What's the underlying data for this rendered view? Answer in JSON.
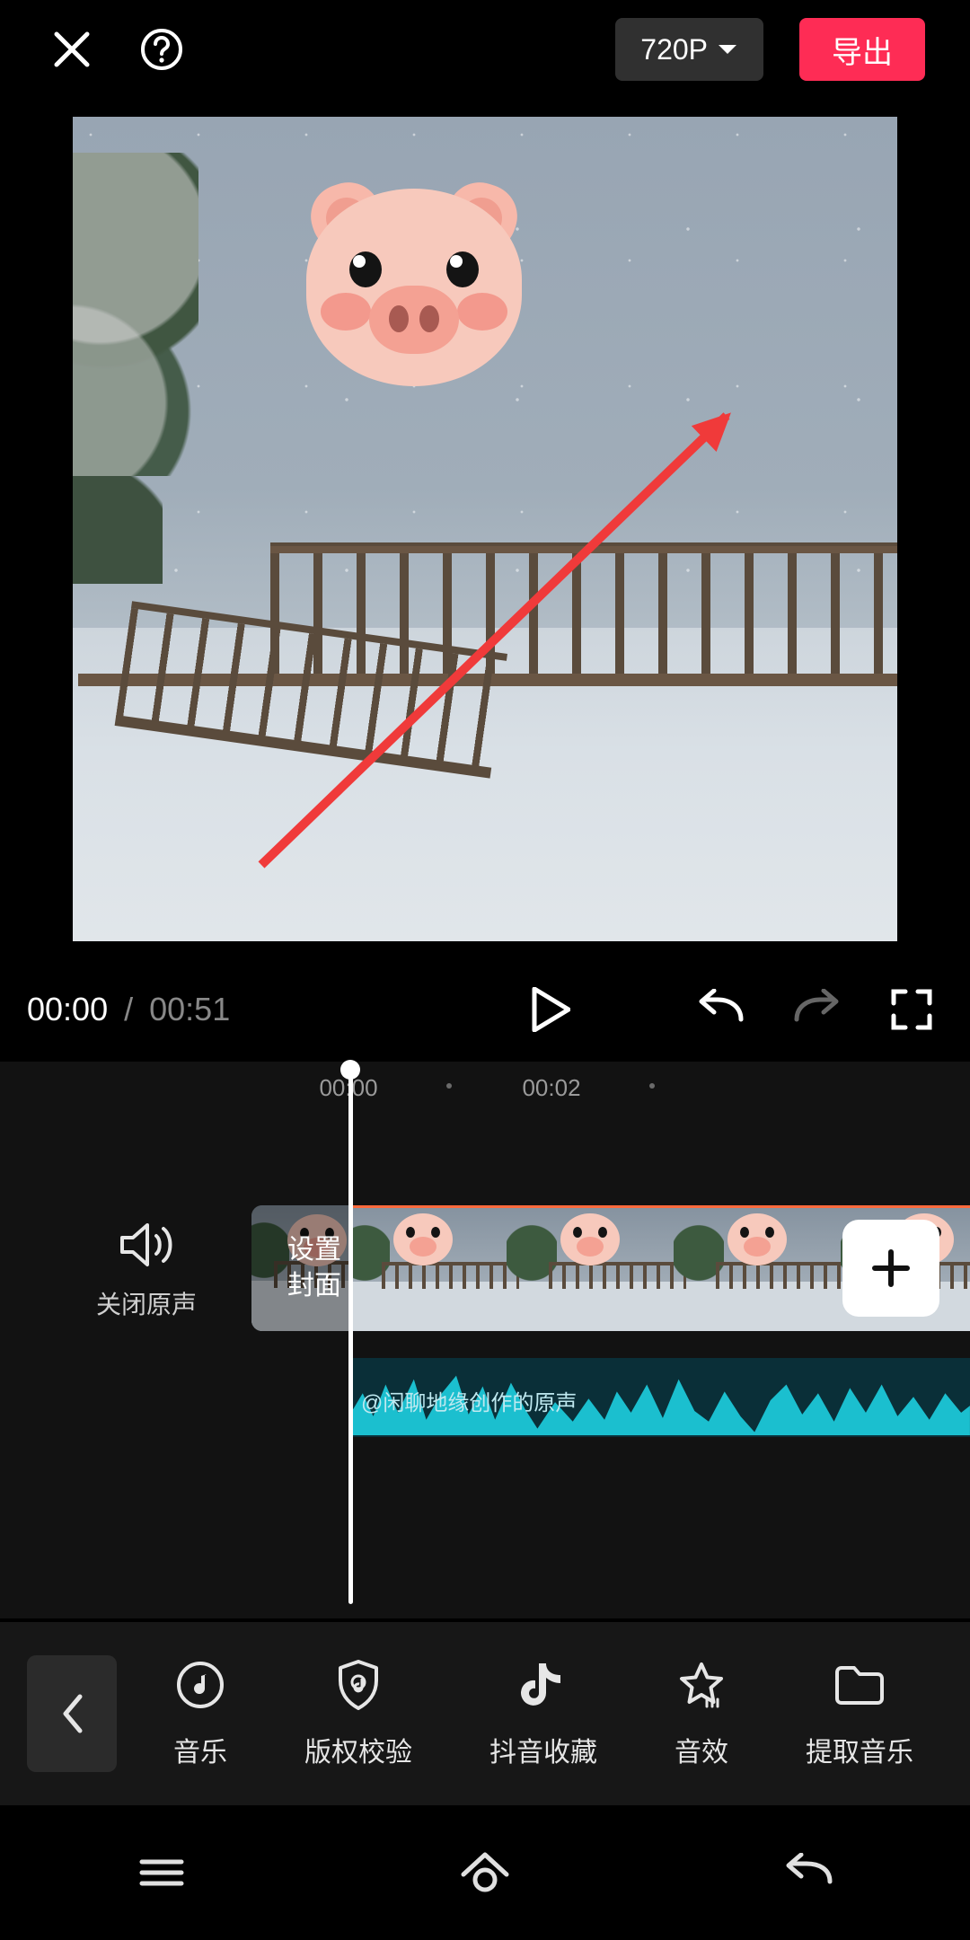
{
  "top": {
    "resolution": "720P",
    "export_label": "导出"
  },
  "transport": {
    "current_time": "00:00",
    "separator": "/",
    "duration": "00:51"
  },
  "ruler": {
    "marks": [
      "00:00",
      "00:02"
    ]
  },
  "timeline": {
    "mute_label": "关闭原声",
    "cover_line1": "设置",
    "cover_line2": "封面",
    "audio_label": "@闲聊地缘创作的原声"
  },
  "toolbar": {
    "items": [
      {
        "label": "音乐"
      },
      {
        "label": "版权校验"
      },
      {
        "label": "抖音收藏"
      },
      {
        "label": "音效"
      },
      {
        "label": "提取音乐"
      }
    ]
  }
}
